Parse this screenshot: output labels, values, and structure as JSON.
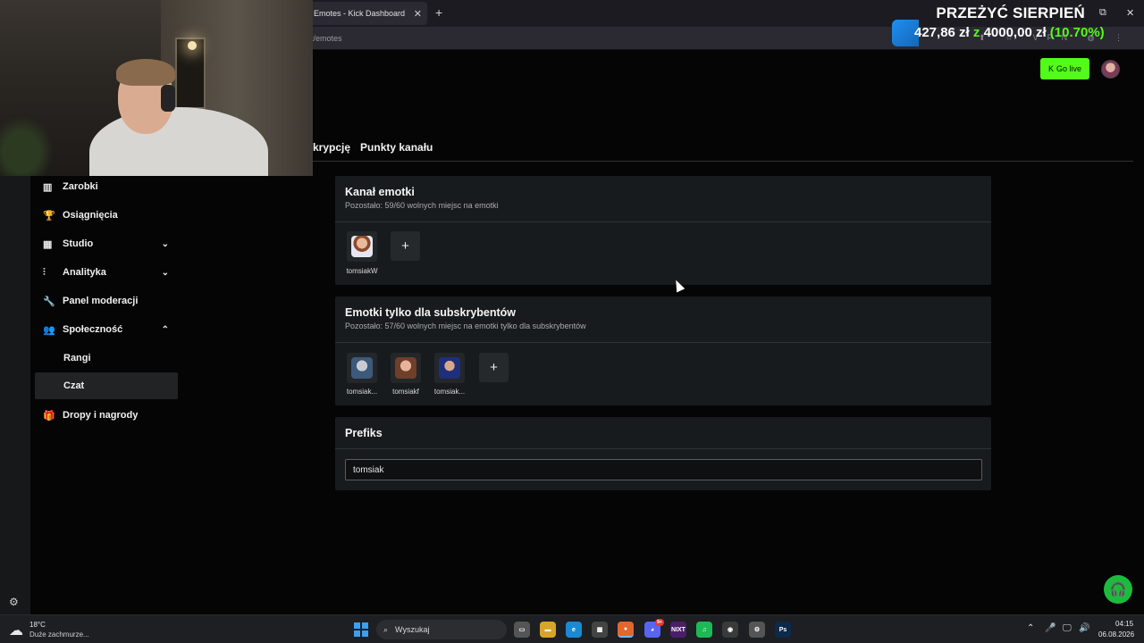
{
  "browser": {
    "tab_title": "Emotes - Kick Dashboard",
    "tab_close": "✕",
    "new_tab": "+",
    "url_fragment": "t/emotes",
    "window_controls": [
      "⧉",
      "✕"
    ],
    "url_icons": "⬆ ☆ VPN ◍ ⋮"
  },
  "header": {
    "go_live_label": "Go live",
    "go_live_icon": "K",
    "accent_color": "#53fc18"
  },
  "subtabs": [
    "krypcję",
    "Punkty kanału"
  ],
  "sidebar": {
    "items": [
      {
        "label": "Zarobki",
        "icon": "chart-icon",
        "glyph": "▥",
        "expand": ""
      },
      {
        "label": "Osiągnięcia",
        "icon": "trophy-icon",
        "glyph": "🏆",
        "expand": ""
      },
      {
        "label": "Studio",
        "icon": "studio-icon",
        "glyph": "▦",
        "expand": "⌄"
      },
      {
        "label": "Analityka",
        "icon": "analytics-icon",
        "glyph": "⫶",
        "expand": "⌄"
      },
      {
        "label": "Panel moderacji",
        "icon": "wrench-icon",
        "glyph": "🔧",
        "expand": ""
      },
      {
        "label": "Społeczność",
        "icon": "community-icon",
        "glyph": "👥",
        "expand": "⌃"
      },
      {
        "label": "Rangi",
        "icon": "",
        "glyph": "",
        "expand": ""
      },
      {
        "label": "Czat",
        "icon": "",
        "glyph": "",
        "expand": ""
      },
      {
        "label": "Dropy i nagrody",
        "icon": "gift-icon",
        "glyph": "🎁",
        "expand": ""
      }
    ],
    "settings_glyph": "⚙"
  },
  "channel_emotes": {
    "title": "Kanał emotki",
    "subtitle": "Pozostało: 59/60 wolnych miejsc na emotki",
    "emotes": [
      {
        "label": "tomsiakW"
      }
    ],
    "add_label": "+"
  },
  "sub_emotes": {
    "title": "Emotki tylko dla subskrybentów",
    "subtitle": "Pozostało: 57/60 wolnych miejsc na emotki tylko dla subskrybentów",
    "emotes": [
      {
        "label": "tomsiak..."
      },
      {
        "label": "tomsiakf"
      },
      {
        "label": "tomsiak..."
      }
    ],
    "add_label": "+"
  },
  "prefix": {
    "title": "Prefiks",
    "value": "tomsiak"
  },
  "support_glyph": "🎧",
  "donation_goal": {
    "title": "PRZEŻYĆ SIERPIEŃ",
    "current": "427,86 zł",
    "of": "z",
    "target": "4000,00 zł",
    "percent": "(10.70%)",
    "progress": 0.107
  },
  "taskbar": {
    "temperature": "18°C",
    "weather_desc": "Duże zachmurze...",
    "search_label": "Wyszukaj",
    "apps": [
      {
        "name": "file-icon",
        "glyph": "▭",
        "color": "#555"
      },
      {
        "name": "folder-icon",
        "glyph": "▬",
        "color": "#d8a42a"
      },
      {
        "name": "edge-icon",
        "glyph": "e",
        "color": "#1a8ad4"
      },
      {
        "name": "store-icon",
        "glyph": "▦",
        "color": "#444"
      },
      {
        "name": "firefox-icon",
        "glyph": "●",
        "color": "#e3662d"
      },
      {
        "name": "discord-icon",
        "glyph": "◕",
        "color": "#5865f2",
        "badge": "9+"
      },
      {
        "name": "nixt-icon",
        "glyph": "NIXT",
        "color": "#4b1e6b"
      },
      {
        "name": "spotify-icon",
        "glyph": "♫",
        "color": "#1db954"
      },
      {
        "name": "obs-icon",
        "glyph": "◉",
        "color": "#3a3a3a"
      },
      {
        "name": "settings-app-icon",
        "glyph": "⚙",
        "color": "#555"
      },
      {
        "name": "photoshop-icon",
        "glyph": "Ps",
        "color": "#0c2a4a"
      }
    ],
    "tray": [
      "⌃",
      "🎤",
      "🖵",
      "🔊"
    ],
    "time": "04:15",
    "date": "06.08.2026"
  }
}
